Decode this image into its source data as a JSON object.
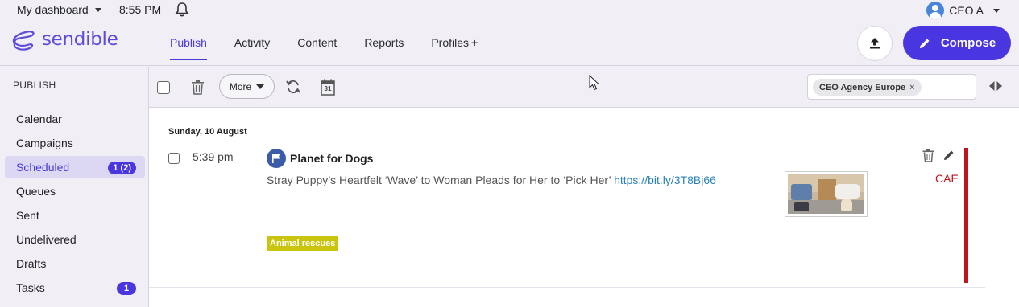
{
  "header": {
    "dashboard_label": "My dashboard",
    "time": "8:55 PM",
    "user_label": "CEO A",
    "logo_text": "sendible",
    "nav": [
      {
        "label": "Publish",
        "active": true
      },
      {
        "label": "Activity",
        "active": false
      },
      {
        "label": "Content",
        "active": false
      },
      {
        "label": "Reports",
        "active": false
      },
      {
        "label": "Profiles",
        "active": false
      }
    ],
    "profiles_plus": "+",
    "compose_label": "Compose",
    "accent_color": "#4a36e0"
  },
  "sidebar": {
    "heading": "PUBLISH",
    "items": [
      {
        "label": "Calendar"
      },
      {
        "label": "Campaigns"
      },
      {
        "label": "Scheduled",
        "badge": "1 (2)",
        "active": true
      },
      {
        "label": "Queues"
      },
      {
        "label": "Sent"
      },
      {
        "label": "Undelivered"
      },
      {
        "label": "Drafts"
      },
      {
        "label": "Tasks",
        "badge": "1"
      }
    ]
  },
  "toolbar": {
    "more_label": "More",
    "calendar_day": "31",
    "profile_chip": "CEO Agency Europe",
    "chip_remove": "×"
  },
  "post": {
    "date": "Sunday, 10 August",
    "time": "5:39 pm",
    "profile_name": "Planet for Dogs",
    "text": "Stray Puppy’s Heartfelt ‘Wave’ to Woman Pleads for Her to ‘Pick Her’",
    "link": "https://bit.ly/3T8Bj66",
    "tag": "Animal rescues",
    "tag_color": "#c9c40d",
    "owner_initials": "CAE",
    "owner_color": "#c0141e"
  }
}
